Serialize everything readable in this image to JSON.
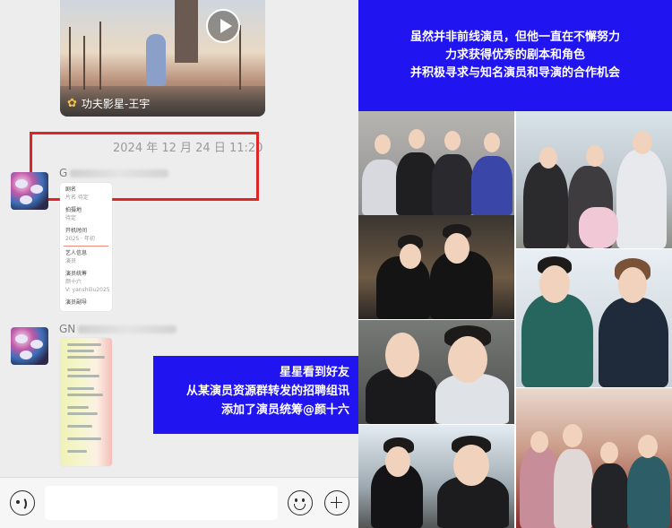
{
  "chat": {
    "video_card": {
      "channel": "功夫影星-王宇",
      "channel_icon": "butterfly-icon"
    },
    "timestamp": "2024 年 12 月 24 日 11:20",
    "messages": [
      {
        "sender_prefix": "G",
        "doc_lines": [
          "剧名",
          "片名 待定",
          "",
          "拍摄地",
          "待定",
          "",
          "开机时间",
          "2025 · 年初",
          "",
          "艺人信息",
          "演员",
          "",
          "演员统筹",
          "颜十六",
          "V: yanshiliu2025",
          "",
          "演员副导"
        ]
      },
      {
        "sender_prefix": "GN"
      }
    ],
    "banner_lines": [
      "星星看到好友",
      "从某演员资源群转发的招聘组讯",
      "添加了演员统筹@颜十六"
    ]
  },
  "input_bar": {
    "placeholder": "",
    "voice_icon": "voice-icon",
    "emoji_icon": "smiley-icon",
    "plus_icon": "plus-icon"
  },
  "collage": {
    "banner_lines": [
      "虽然并非前线演员，但他一直在不懈努力",
      "力求获得优秀的剧本和角色",
      "并积极寻求与知名演员和导演的合作机会"
    ]
  },
  "colors": {
    "banner_blue": "#2014f0",
    "highlight_red": "#e02424",
    "chat_bg": "#ededed"
  }
}
